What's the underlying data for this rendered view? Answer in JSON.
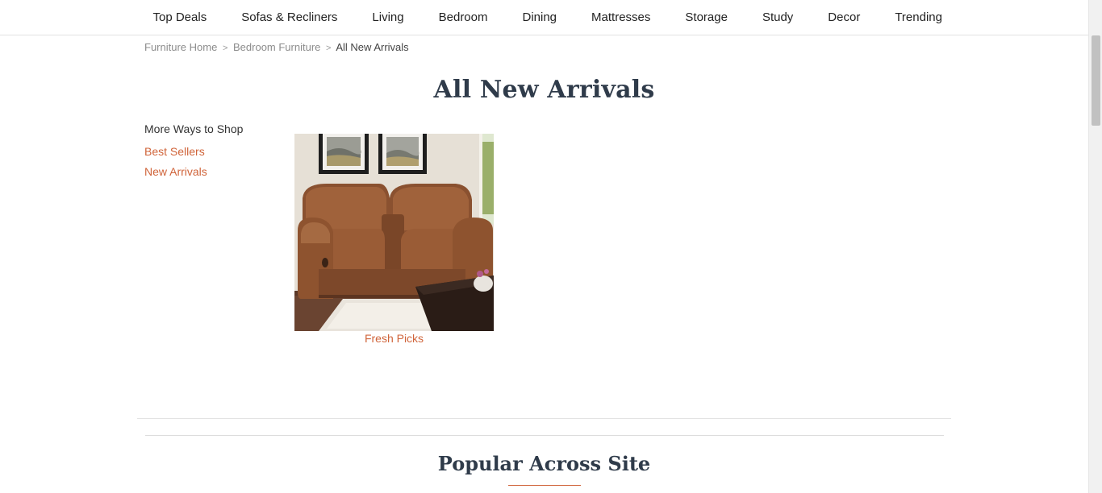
{
  "nav": {
    "items": [
      "Top Deals",
      "Sofas & Recliners",
      "Living",
      "Bedroom",
      "Dining",
      "Mattresses",
      "Storage",
      "Study",
      "Decor",
      "Trending"
    ]
  },
  "breadcrumb": {
    "home": "Furniture Home",
    "category": "Bedroom Furniture",
    "current": "All New Arrivals",
    "separator": ">"
  },
  "page": {
    "title": "All New Arrivals"
  },
  "sidebar": {
    "title": "More Ways to Shop",
    "links": [
      "Best Sellers",
      "New Arrivals"
    ]
  },
  "product": {
    "caption": "Fresh Picks"
  },
  "popular": {
    "title": "Popular Across Site"
  },
  "colors": {
    "accent": "#d0643a",
    "heading": "#2f3b4a",
    "text": "#333333"
  }
}
